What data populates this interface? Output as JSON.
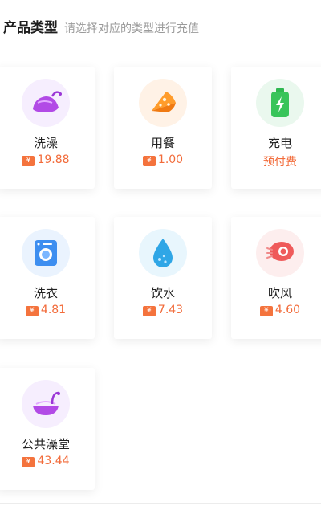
{
  "header": {
    "title": "产品类型",
    "subtitle": "请选择对应的类型进行充值"
  },
  "currency_symbol": "¥",
  "products": [
    {
      "name": "洗澡",
      "price": "19.88",
      "icon": "bath-icon"
    },
    {
      "name": "用餐",
      "price": "1.00",
      "icon": "meal-icon"
    },
    {
      "name": "充电",
      "price": "预付费",
      "icon": "battery-icon"
    },
    {
      "name": "洗衣",
      "price": "4.81",
      "icon": "washing-machine-icon"
    },
    {
      "name": "饮水",
      "price": "7.43",
      "icon": "water-drop-icon"
    },
    {
      "name": "吹风",
      "price": "4.60",
      "icon": "hair-dryer-icon"
    },
    {
      "name": "公共澡堂",
      "price": "43.44",
      "icon": "public-bath-icon"
    }
  ],
  "colors": {
    "price": "#f26b3a",
    "badge": "#f4733d"
  }
}
